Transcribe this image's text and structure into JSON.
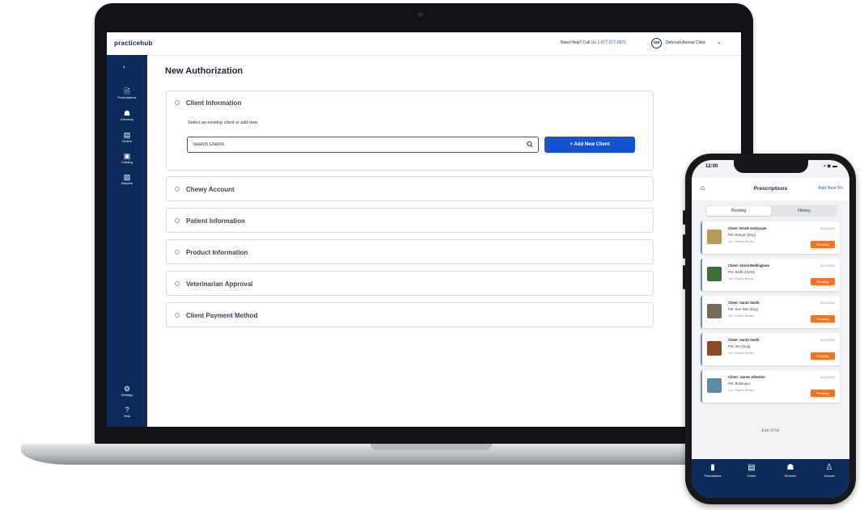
{
  "desktop": {
    "logo": "practicehub",
    "help_text": "Need Help? Call Us ",
    "help_phone": "1-877-977-0870",
    "user_initials": "DM",
    "user_name": "Deborah Animal Clinic",
    "sidebar": {
      "items": [
        {
          "label": "Prescriptions",
          "icon": "prescription-bottle-icon",
          "glyph": "🗎"
        },
        {
          "label": "Directory",
          "icon": "paw-icon",
          "glyph": "☗"
        },
        {
          "label": "Orders",
          "icon": "clipboard-icon",
          "glyph": "▤"
        },
        {
          "label": "Catalog",
          "icon": "catalog-icon",
          "glyph": "▣"
        },
        {
          "label": "Reports",
          "icon": "reports-icon",
          "glyph": "▨"
        }
      ],
      "bottom_items": [
        {
          "label": "Settings",
          "icon": "gear-icon",
          "glyph": "⚙"
        },
        {
          "label": "Help",
          "icon": "help-icon",
          "glyph": "?"
        }
      ]
    },
    "page_title": "New Authorization",
    "client_section": {
      "title": "Client Information",
      "hint": "Select an existing client or add new",
      "search_placeholder": "Search Clients",
      "add_button": "+ Add New Client"
    },
    "sections": [
      {
        "title": "Chewy Account"
      },
      {
        "title": "Patient Information"
      },
      {
        "title": "Product Information"
      },
      {
        "title": "Veterinarian Approval"
      },
      {
        "title": "Client Payment Method"
      }
    ]
  },
  "mobile": {
    "time": "12:00",
    "status": "▪ ◉ ▬",
    "title": "Prescriptions",
    "add_link": "Add New Rx",
    "tabs": [
      "Pending",
      "History"
    ],
    "cards": [
      {
        "client": "Client: Emrik Gorbyzam",
        "pet": "Pet: Ranger (Dog)",
        "line3": "Vet: Shane Becks",
        "date": "6/21/2023",
        "status": "Pending",
        "thumb_color": "#b89a5a"
      },
      {
        "client": "Client: Abrial Bedlingham",
        "pet": "Pet: Barki (Horse)",
        "line3": "Vet: Shane Becks",
        "date": "6/21/2023",
        "status": "Pending",
        "thumb_color": "#3d6f3a"
      },
      {
        "client": "Client: Sarah Smith",
        "pet": "Pet: Dee-Dee (Dog)",
        "line3": "Vet: Shane Becks",
        "date": "6/21/2023",
        "status": "Pending",
        "thumb_color": "#7a6a58"
      },
      {
        "client": "Client: Sarah Smith",
        "pet": "Pet: Zen (Dog)",
        "line3": "Vet: Shane Becks",
        "date": "6/21/2023",
        "status": "Pending",
        "thumb_color": "#8a4a2a"
      },
      {
        "client": "Client: James Atherton",
        "pet": "Pet: Buttonpeo",
        "line3": "Vet: Shane Becks",
        "date": "6/21/2023",
        "status": "Pending",
        "thumb_color": "#5a8aa8"
      }
    ],
    "end_text": "End of list",
    "tabbar": [
      {
        "label": "Prescriptions",
        "icon": "prescription-icon",
        "glyph": "▮"
      },
      {
        "label": "Orders",
        "icon": "orders-icon",
        "glyph": "▤"
      },
      {
        "label": "Directory",
        "icon": "directory-icon",
        "glyph": "☗"
      },
      {
        "label": "Account",
        "icon": "account-icon",
        "glyph": "♙"
      }
    ]
  },
  "colors": {
    "navy": "#0c2b5b",
    "primary_button": "#1453d0",
    "pending_badge": "#f27321"
  }
}
